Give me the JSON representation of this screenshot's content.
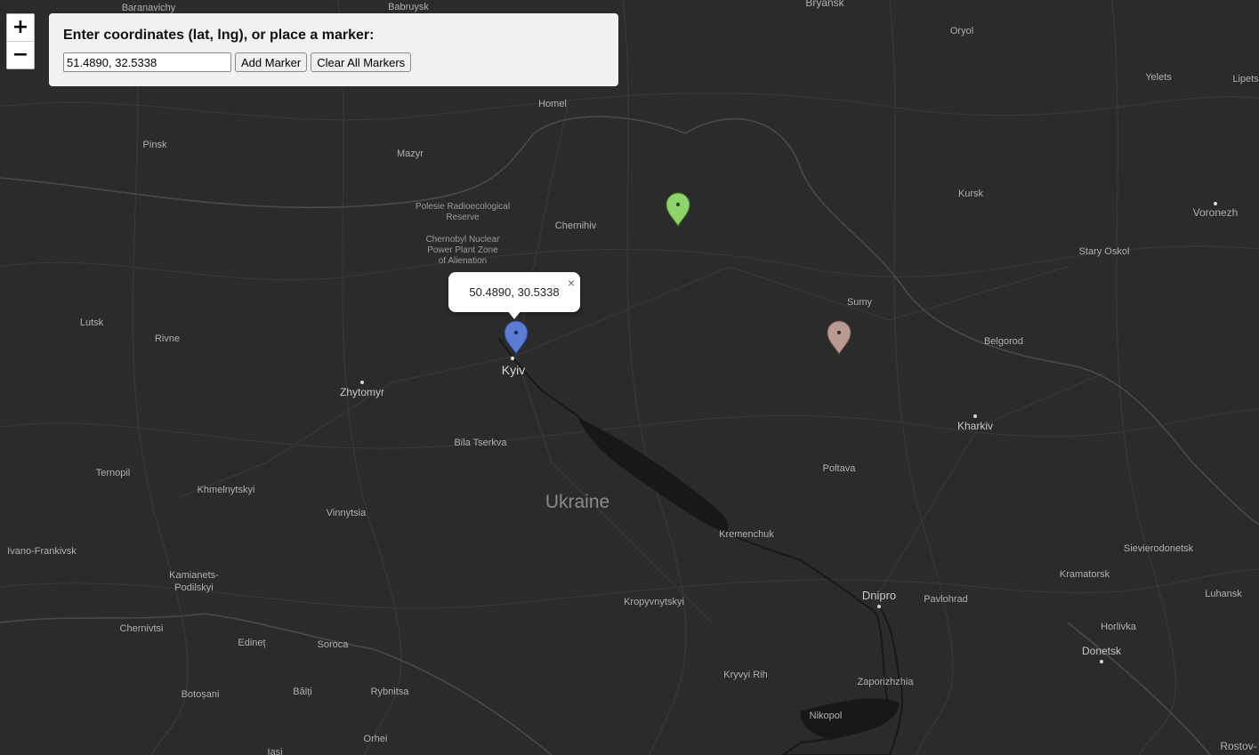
{
  "control_panel": {
    "title": "Enter coordinates (lat, lng), or place a marker:",
    "input_value": "51.4890, 32.5338",
    "add_marker_label": "Add Marker",
    "clear_markers_label": "Clear All Markers"
  },
  "zoom": {
    "in_label": "+",
    "out_label": "−"
  },
  "popup": {
    "text": "50.4890, 30.5338",
    "close_label": "×"
  },
  "markers": [
    {
      "name": "blue-map-marker",
      "color": "#5b7bd5"
    },
    {
      "name": "green-map-marker",
      "color": "#8ed46a"
    },
    {
      "name": "pink-map-marker",
      "color": "#b99b93"
    }
  ],
  "map_labels": {
    "country": "Ukraine",
    "cities": [
      "Baranavichy",
      "Babruysk",
      "Bryansk",
      "Oryol",
      "Yelets",
      "Lipets",
      "Homel",
      "Pinsk",
      "Mazyr",
      "Kursk",
      "Voronezh",
      "Chernihiv",
      "Stary Oskol",
      "Sumy",
      "Lutsk",
      "Rivne",
      "Belgorod",
      "Kyiv",
      "Zhytomyr",
      "Kharkiv",
      "Bila Tserkva",
      "Poltava",
      "Ternopil",
      "Khmelnytskyi",
      "Vinnytsia",
      "Kremenchuk",
      "Sievierodonetsk",
      "Ivano-Frankivsk",
      "Kramatorsk",
      "Kamianets-",
      "Podilskyi",
      "Luhansk",
      "Dnipro",
      "Pavlohrad",
      "Kropyvnytskyi",
      "Chernivtsi",
      "Edineț",
      "Soroca",
      "Horlivka",
      "Donetsk",
      "Botoșani",
      "Bălți",
      "Rybnitsa",
      "Kryvyi Rih",
      "Zaporizhzhia",
      "Nikopol",
      "Orhei",
      "Iasi",
      "Rostov-"
    ],
    "areas": [
      "Polesie Radioecological",
      "Reserve",
      "Chernobyl Nuclear",
      "Power Plant Zone",
      "of Alienation"
    ]
  }
}
